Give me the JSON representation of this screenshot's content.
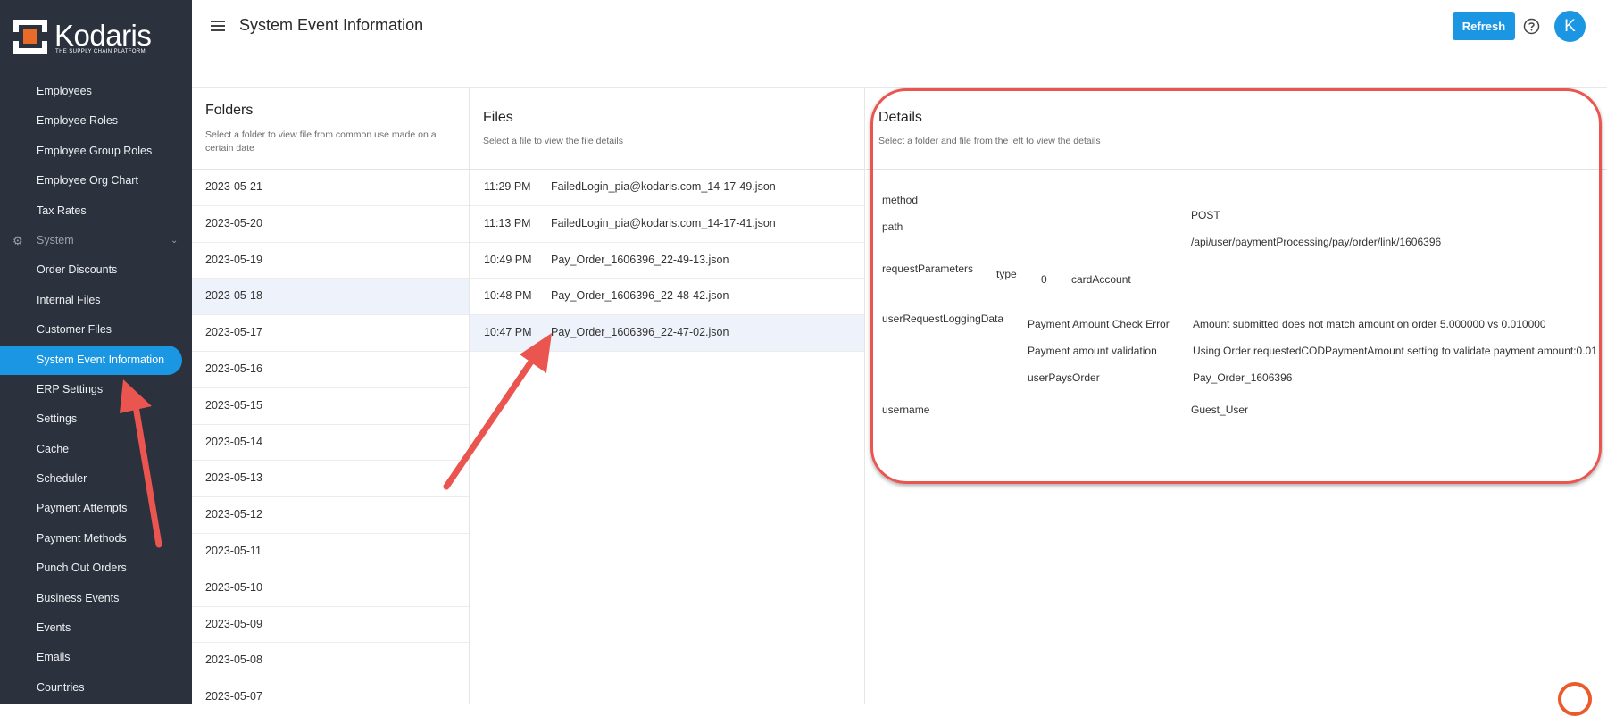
{
  "brand": {
    "name": "Kodaris",
    "tagline": "THE SUPPLY CHAIN PLATFORM"
  },
  "sidebar": {
    "items": [
      {
        "label": "Employees"
      },
      {
        "label": "Employee Roles"
      },
      {
        "label": "Employee Group Roles"
      },
      {
        "label": "Employee Org Chart"
      },
      {
        "label": "Tax Rates"
      },
      {
        "label": "System",
        "group": true
      },
      {
        "label": "Order Discounts"
      },
      {
        "label": "Internal Files"
      },
      {
        "label": "Customer Files"
      },
      {
        "label": "System Event Information",
        "active": true
      },
      {
        "label": "ERP Settings"
      },
      {
        "label": "Settings"
      },
      {
        "label": "Cache"
      },
      {
        "label": "Scheduler"
      },
      {
        "label": "Payment Attempts"
      },
      {
        "label": "Payment Methods"
      },
      {
        "label": "Punch Out Orders"
      },
      {
        "label": "Business Events"
      },
      {
        "label": "Events"
      },
      {
        "label": "Emails"
      },
      {
        "label": "Countries"
      }
    ]
  },
  "header": {
    "title": "System Event Information",
    "refresh_label": "Refresh",
    "avatar_initial": "K"
  },
  "folders": {
    "title": "Folders",
    "subtitle": "Select a folder to view file from common use made on a certain date",
    "items": [
      "2023-05-21",
      "2023-05-20",
      "2023-05-19",
      "2023-05-18",
      "2023-05-17",
      "2023-05-16",
      "2023-05-15",
      "2023-05-14",
      "2023-05-13",
      "2023-05-12",
      "2023-05-11",
      "2023-05-10",
      "2023-05-09",
      "2023-05-08",
      "2023-05-07"
    ],
    "selected_index": 3
  },
  "files": {
    "title": "Files",
    "subtitle": "Select a file to view the file details",
    "items": [
      {
        "time": "11:29 PM",
        "name": "FailedLogin_pia@kodaris.com_14-17-49.json"
      },
      {
        "time": "11:13 PM",
        "name": "FailedLogin_pia@kodaris.com_14-17-41.json"
      },
      {
        "time": "10:49 PM",
        "name": "Pay_Order_1606396_22-49-13.json"
      },
      {
        "time": "10:48 PM",
        "name": "Pay_Order_1606396_22-48-42.json"
      },
      {
        "time": "10:47 PM",
        "name": "Pay_Order_1606396_22-47-02.json"
      }
    ],
    "selected_index": 4
  },
  "details": {
    "title": "Details",
    "subtitle": "Select a folder and file from the left to view the details",
    "method_key": "method",
    "method_value": "POST",
    "path_key": "path",
    "path_value": "/api/user/paymentProcessing/pay/order/link/1606396",
    "request_key": "requestParameters",
    "request_sub_key": "type",
    "request_sub_index": "0",
    "request_sub_value": "cardAccount",
    "logging_key": "userRequestLoggingData",
    "logging_rows": [
      {
        "key": "Payment Amount Check Error",
        "value": "Amount submitted does not match amount on order 5.000000 vs 0.010000"
      },
      {
        "key": "Payment amount validation",
        "value": "Using Order requestedCODPaymentAmount setting to validate payment amount:0.01"
      },
      {
        "key": "userPaysOrder",
        "value": "Pay_Order_1606396"
      }
    ],
    "username_key": "username",
    "username_value": "Guest_User"
  },
  "colors": {
    "accent": "#1a96e3",
    "sidebar_bg": "#2b313d",
    "annotation": "#ea5550"
  }
}
